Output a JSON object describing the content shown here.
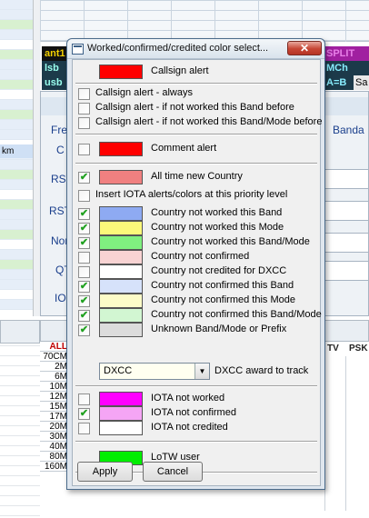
{
  "background": {
    "left_text": "km",
    "strips": [
      "ant1",
      "lsb",
      "usb"
    ],
    "right_strips": [
      "SPLIT",
      "MCh",
      "A=B",
      "Sa"
    ],
    "labels": [
      "Fre",
      "C",
      "RST",
      "RST",
      "Nor",
      "QT",
      "IO",
      "Banda"
    ],
    "bands": [
      "ALL",
      "70CM",
      "2M",
      "6M",
      "10M",
      "12M",
      "15M",
      "17M",
      "20M",
      "30M",
      "40M",
      "80M",
      "160M"
    ],
    "col_heads": [
      "TV",
      "PSK"
    ]
  },
  "dialog": {
    "title": "Worked/confirmed/credited color select...",
    "close_symbol": "✕",
    "items": [
      {
        "label": "Callsign alert",
        "has_checkbox": false,
        "checked": false,
        "color": "#ff0000"
      },
      {
        "label": "Callsign alert - always",
        "has_checkbox": true,
        "checked": false,
        "color": null
      },
      {
        "label": "Callsign alert - if not worked this Band before",
        "has_checkbox": true,
        "checked": false,
        "color": null
      },
      {
        "label": "Callsign alert - if not worked this Band/Mode before",
        "has_checkbox": true,
        "checked": false,
        "color": null
      },
      {
        "label": "Comment alert",
        "has_checkbox": true,
        "checked": false,
        "color": "#ff0000"
      },
      {
        "label": "All time new Country",
        "has_checkbox": true,
        "checked": true,
        "color": "#f08080"
      },
      {
        "label": "Insert IOTA alerts/colors at this priority level",
        "has_checkbox": true,
        "checked": false,
        "color": null
      },
      {
        "label": "Country not worked this Band",
        "has_checkbox": true,
        "checked": true,
        "color": "#8eaaf2"
      },
      {
        "label": "Country not worked this Mode",
        "has_checkbox": true,
        "checked": true,
        "color": "#fbf97a"
      },
      {
        "label": "Country not worked this Band/Mode",
        "has_checkbox": true,
        "checked": true,
        "color": "#80f080"
      },
      {
        "label": "Country not confirmed",
        "has_checkbox": true,
        "checked": false,
        "color": "#f8d3d3"
      },
      {
        "label": "Country not credited for DXCC",
        "has_checkbox": true,
        "checked": false,
        "color": "#ffffff"
      },
      {
        "label": "Country not confirmed this Band",
        "has_checkbox": true,
        "checked": true,
        "color": "#d6e2fa"
      },
      {
        "label": "Country not confirmed this Mode",
        "has_checkbox": true,
        "checked": true,
        "color": "#fcfcc8"
      },
      {
        "label": "Country not confirmed this Band/Mode",
        "has_checkbox": true,
        "checked": true,
        "color": "#d2f6d2"
      },
      {
        "label": "Unknown Band/Mode or Prefix",
        "has_checkbox": true,
        "checked": true,
        "color": "#dcdcdc"
      },
      {
        "label": "IOTA not worked",
        "has_checkbox": true,
        "checked": false,
        "color": "#ff00ff"
      },
      {
        "label": "IOTA not confirmed",
        "has_checkbox": true,
        "checked": true,
        "color": "#f5a5f5"
      },
      {
        "label": "IOTA not credited",
        "has_checkbox": true,
        "checked": false,
        "color": "#ffffff"
      },
      {
        "label": "LoTW user",
        "has_checkbox": false,
        "checked": false,
        "color": "#00ee00"
      }
    ],
    "award_select": {
      "value": "DXCC",
      "label": "DXCC award to track"
    },
    "apply_label": "Apply",
    "cancel_label": "Cancel"
  }
}
